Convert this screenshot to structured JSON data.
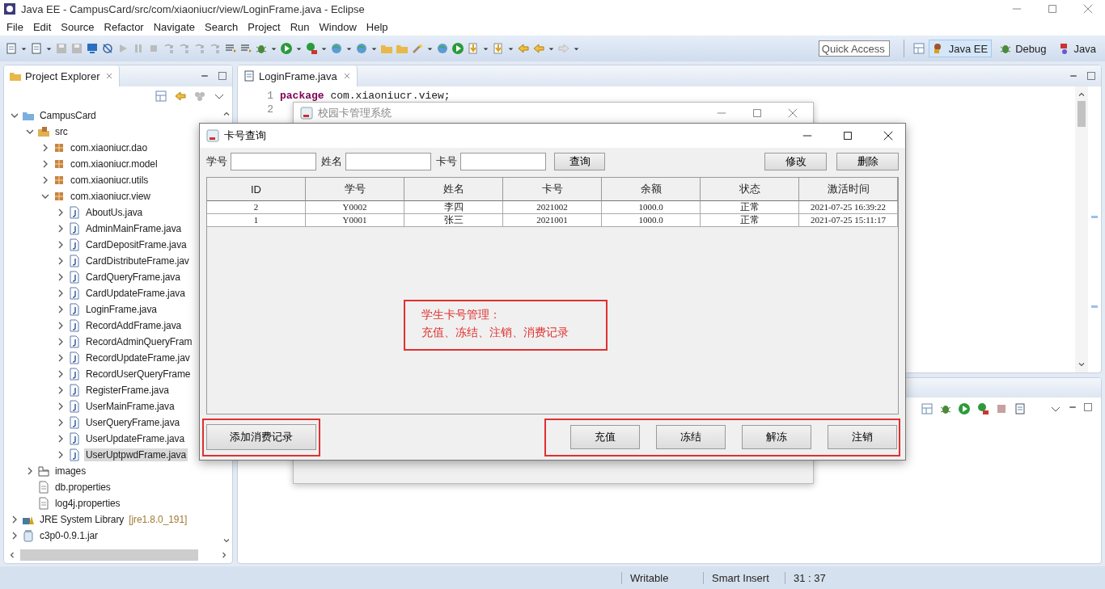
{
  "window": {
    "title": "Java EE - CampusCard/src/com/xiaoniucr/view/LoginFrame.java - Eclipse"
  },
  "menu": [
    "File",
    "Edit",
    "Source",
    "Refactor",
    "Navigate",
    "Search",
    "Project",
    "Run",
    "Window",
    "Help"
  ],
  "toolbar": {
    "quick_access": {
      "placeholder": "Quick Access"
    },
    "perspectives": [
      {
        "label": "Java EE",
        "selected": true
      },
      {
        "label": "Debug",
        "selected": false
      },
      {
        "label": "Java",
        "selected": false
      }
    ]
  },
  "project_explorer": {
    "title": "Project Explorer",
    "tree": [
      {
        "label": "CampusCard",
        "kind": "project",
        "expanded": true,
        "selected": false,
        "children": [
          {
            "label": "src",
            "kind": "source",
            "expanded": true,
            "selected": false,
            "children": [
              {
                "label": "com.xiaoniucr.dao",
                "kind": "package",
                "expanded": false,
                "selected": false
              },
              {
                "label": "com.xiaoniucr.model",
                "kind": "package",
                "expanded": false,
                "selected": false
              },
              {
                "label": "com.xiaoniucr.utils",
                "kind": "package",
                "expanded": false,
                "selected": false
              },
              {
                "label": "com.xiaoniucr.view",
                "kind": "package",
                "expanded": true,
                "selected": false,
                "children": [
                  {
                    "label": "AboutUs.java",
                    "kind": "java",
                    "expanded": false,
                    "selected": false
                  },
                  {
                    "label": "AdminMainFrame.java",
                    "kind": "java",
                    "expanded": false,
                    "selected": false
                  },
                  {
                    "label": "CardDepositFrame.java",
                    "kind": "java",
                    "expanded": false,
                    "selected": false
                  },
                  {
                    "label": "CardDistributeFrame.jav",
                    "kind": "java",
                    "expanded": false,
                    "selected": false
                  },
                  {
                    "label": "CardQueryFrame.java",
                    "kind": "java",
                    "expanded": false,
                    "selected": false
                  },
                  {
                    "label": "CardUpdateFrame.java",
                    "kind": "java",
                    "expanded": false,
                    "selected": false
                  },
                  {
                    "label": "LoginFrame.java",
                    "kind": "java",
                    "expanded": false,
                    "selected": false
                  },
                  {
                    "label": "RecordAddFrame.java",
                    "kind": "java",
                    "expanded": false,
                    "selected": false
                  },
                  {
                    "label": "RecordAdminQueryFram",
                    "kind": "java",
                    "expanded": false,
                    "selected": false
                  },
                  {
                    "label": "RecordUpdateFrame.jav",
                    "kind": "java",
                    "expanded": false,
                    "selected": false
                  },
                  {
                    "label": "RecordUserQueryFrame",
                    "kind": "java",
                    "expanded": false,
                    "selected": false
                  },
                  {
                    "label": "RegisterFrame.java",
                    "kind": "java",
                    "expanded": false,
                    "selected": false
                  },
                  {
                    "label": "UserMainFrame.java",
                    "kind": "java",
                    "expanded": false,
                    "selected": false
                  },
                  {
                    "label": "UserQueryFrame.java",
                    "kind": "java",
                    "expanded": false,
                    "selected": false
                  },
                  {
                    "label": "UserUpdateFrame.java",
                    "kind": "java",
                    "expanded": false,
                    "selected": false
                  },
                  {
                    "label": "UserUptpwdFrame.java",
                    "kind": "java",
                    "expanded": false,
                    "selected": true
                  }
                ]
              }
            ]
          },
          {
            "label": "images",
            "kind": "folder",
            "expanded": false,
            "selected": false
          },
          {
            "label": "db.properties",
            "kind": "file",
            "selected": false
          },
          {
            "label": "log4j.properties",
            "kind": "file",
            "selected": false
          }
        ]
      },
      {
        "label": "JRE System Library",
        "decoration": "[jre1.8.0_191]",
        "kind": "library",
        "expanded": false,
        "selected": false
      },
      {
        "label": "c3p0-0.9.1.jar",
        "kind": "jar",
        "expanded": false,
        "selected": false
      }
    ]
  },
  "editor": {
    "tab": "LoginFrame.java",
    "lines": [
      {
        "number": "1",
        "segments": [
          {
            "kind": "keyword",
            "text": "package"
          },
          {
            "kind": "plain",
            "text": " com.xiaoniucr.view;"
          }
        ]
      },
      {
        "number": "2"
      }
    ]
  },
  "back_window": {
    "title": "校园卡管理系统"
  },
  "dialog": {
    "title": "卡号查询",
    "filters": [
      {
        "label": "学号"
      },
      {
        "label": "姓名"
      },
      {
        "label": "卡号"
      }
    ],
    "search_button": "查询",
    "action_buttons": [
      "修改",
      "删除"
    ],
    "table": {
      "columns": [
        "ID",
        "学号",
        "姓名",
        "卡号",
        "余额",
        "状态",
        "激活时间"
      ],
      "rows": [
        [
          "2",
          "Y0002",
          "李四",
          "2021002",
          "1000.0",
          "正常",
          "2021-07-25 16:39:22"
        ],
        [
          "1",
          "Y0001",
          "张三",
          "2021001",
          "1000.0",
          "正常",
          "2021-07-25 15:11:17"
        ]
      ]
    },
    "note": {
      "lines": [
        "学生卡号管理：",
        "充值、冻结、注销、消费记录"
      ]
    },
    "left_buttons": [
      "添加消费记录"
    ],
    "right_buttons": [
      "充值",
      "冻结",
      "解冻",
      "注销"
    ]
  },
  "status_bar": [
    "Writable",
    "Smart Insert",
    "31 : 37"
  ]
}
